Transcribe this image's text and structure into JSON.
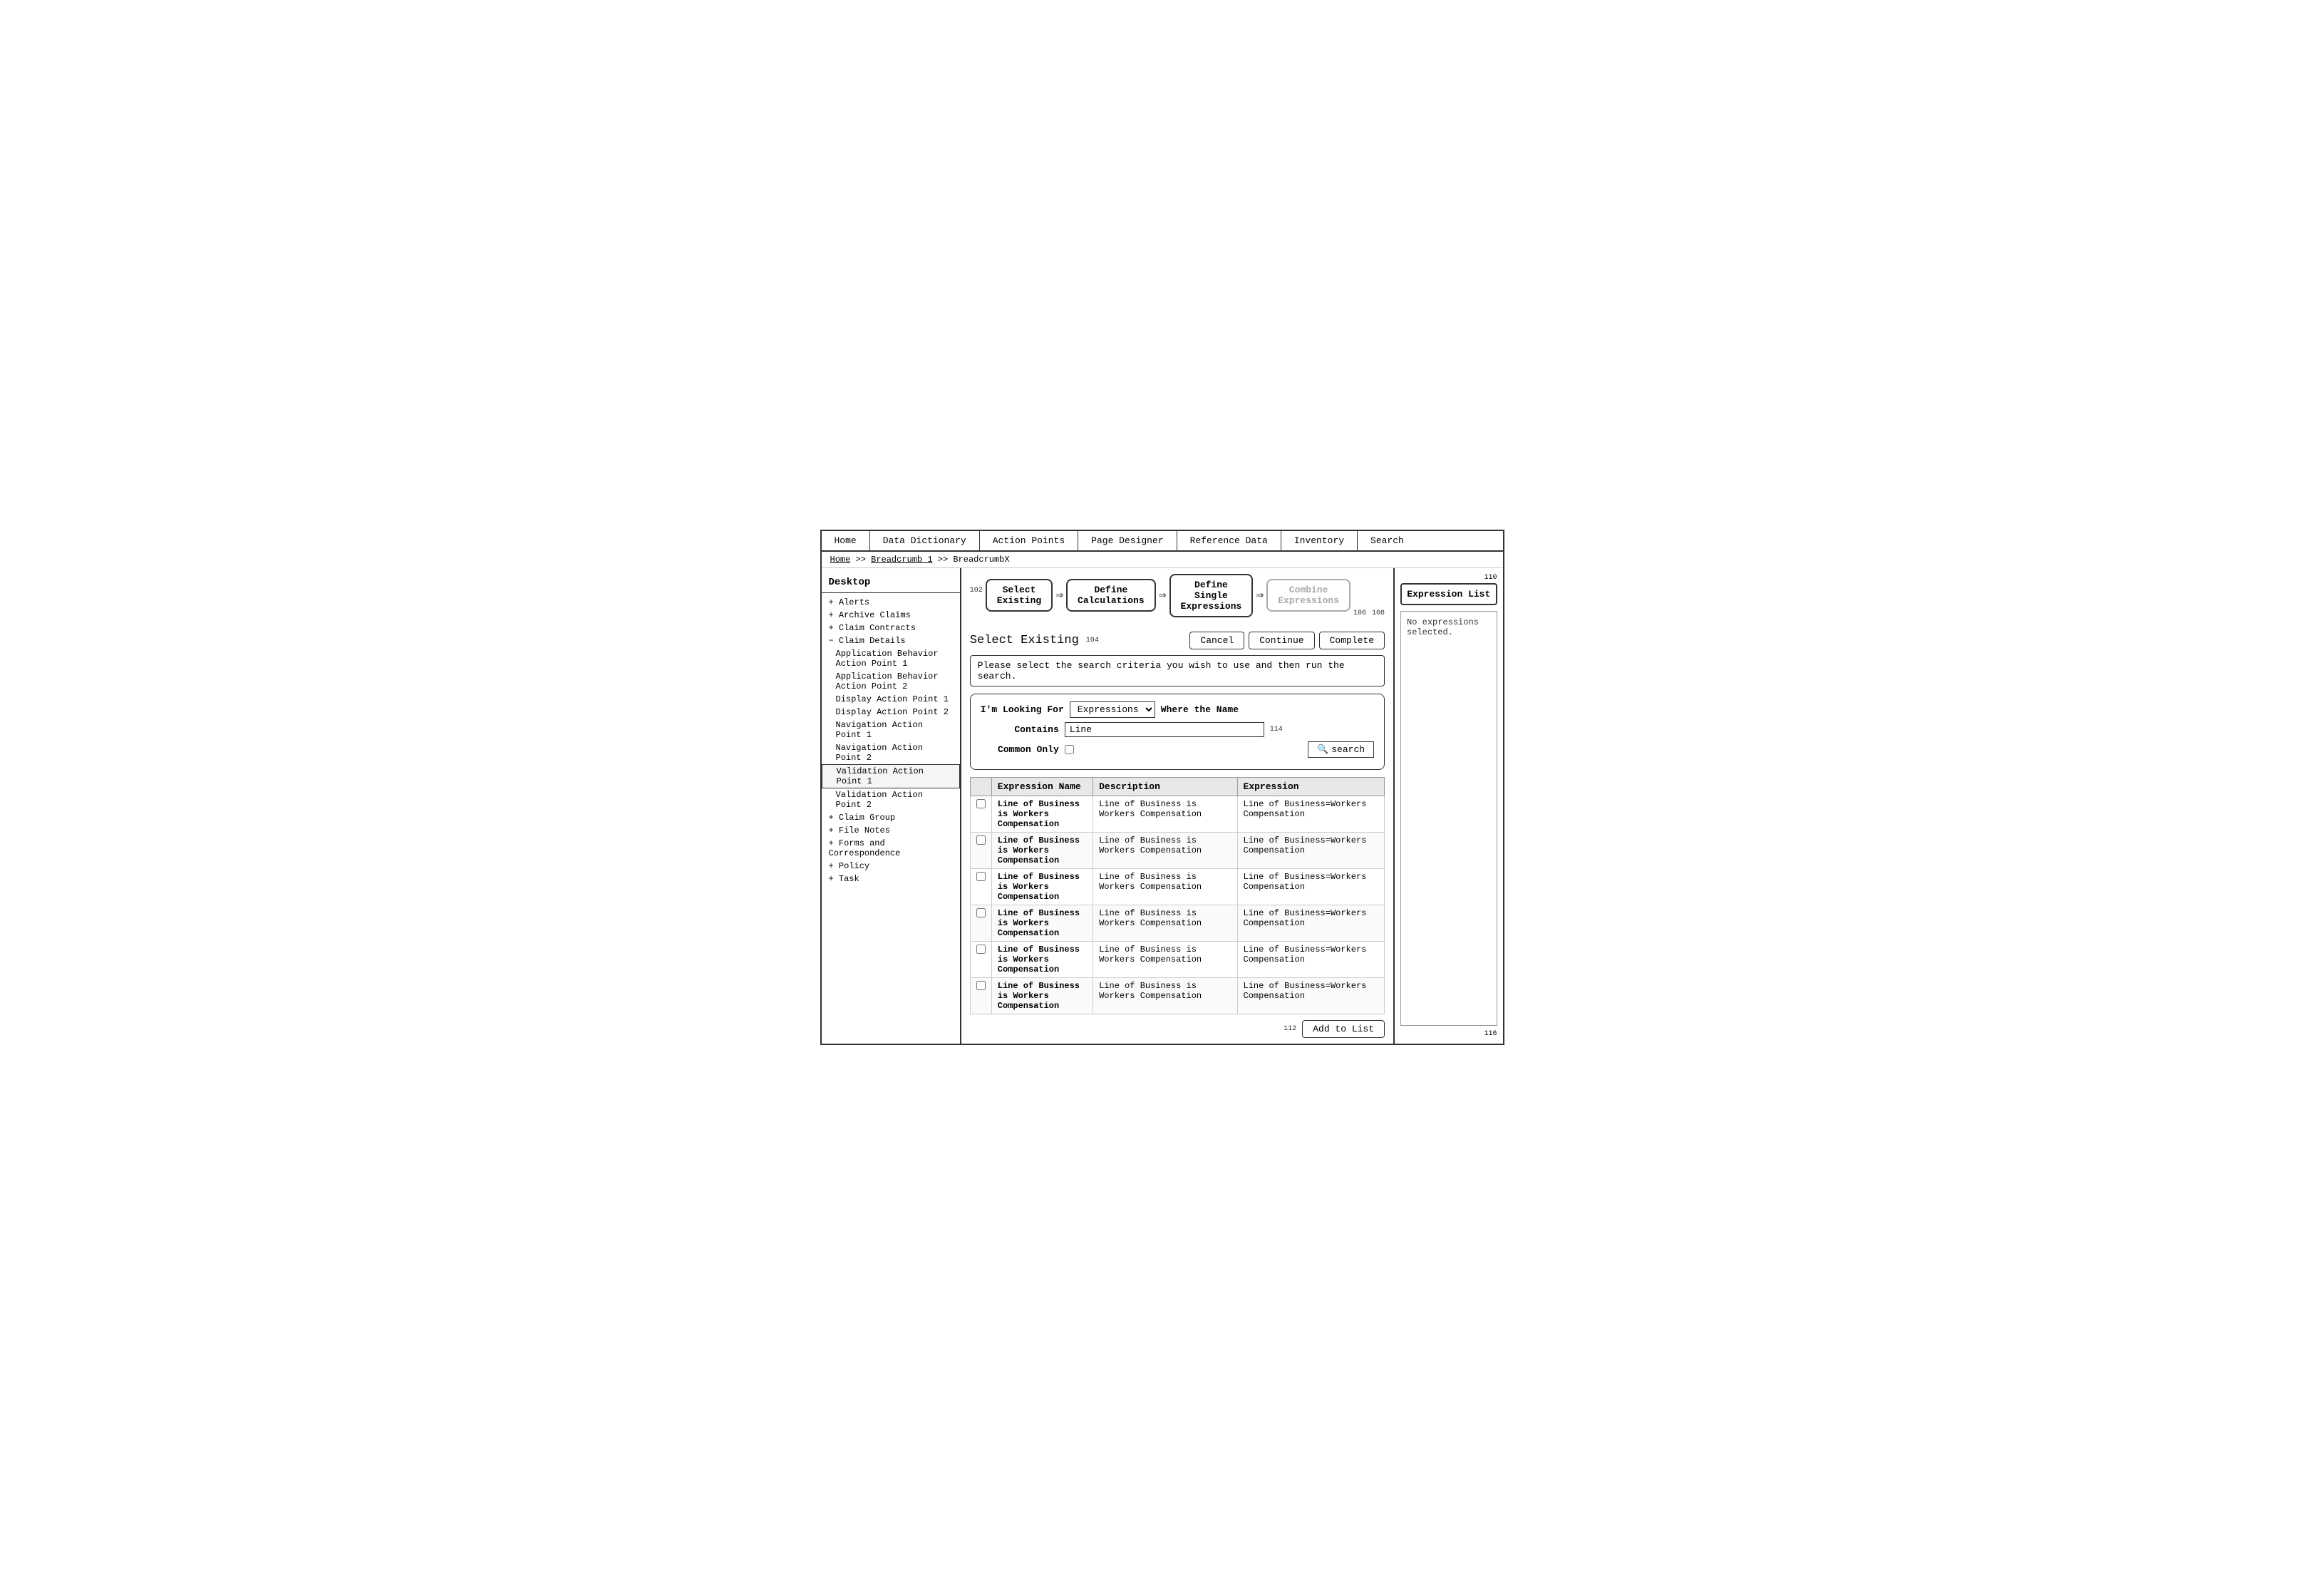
{
  "nav": {
    "items": [
      "Home",
      "Data Dictionary",
      "Action Points",
      "Page Designer",
      "Reference Data",
      "Inventory",
      "Search"
    ]
  },
  "breadcrumb": {
    "home": "Home",
    "separator1": ">>",
    "crumb1": "Breadcrumb 1",
    "separator2": ">>",
    "crumbX": "BreadcrumbX"
  },
  "sidebar": {
    "title": "Desktop",
    "items": [
      {
        "label": "+ Alerts",
        "indent": 0
      },
      {
        "label": "+ Archive Claims",
        "indent": 0
      },
      {
        "label": "+ Claim Contracts",
        "indent": 0
      },
      {
        "label": "− Claim Details",
        "indent": 0
      },
      {
        "label": "Application Behavior Action Point 1",
        "indent": 1
      },
      {
        "label": "Application Behavior Action Point 2",
        "indent": 1
      },
      {
        "label": "Display Action Point 1",
        "indent": 1
      },
      {
        "label": "Display Action Point 2",
        "indent": 1
      },
      {
        "label": "Navigation Action Point 1",
        "indent": 1
      },
      {
        "label": "Navigation Action Point 2",
        "indent": 1
      },
      {
        "label": "Validation Action Point 1",
        "indent": 1,
        "selected": true
      },
      {
        "label": "Validation Action Point 2",
        "indent": 1
      },
      {
        "label": "+ Claim Group",
        "indent": 0
      },
      {
        "label": "+ File Notes",
        "indent": 0
      },
      {
        "label": "+ Forms and Correspondence",
        "indent": 0
      },
      {
        "label": "+ Policy",
        "indent": 0
      },
      {
        "label": "+ Task",
        "indent": 0
      }
    ]
  },
  "wizard": {
    "ref102": "102",
    "steps": [
      {
        "label": "Select\nExisting",
        "active": true
      },
      {
        "label": "Define\nCalculations",
        "active": false
      },
      {
        "label": "Define\nSingle\nExpressions",
        "active": false
      },
      {
        "label": "Combine\nExpressions",
        "disabled": true
      }
    ],
    "ref106": "106",
    "ref108": "108"
  },
  "section": {
    "title": "Select Existing",
    "ref104": "104",
    "buttons": {
      "cancel": "Cancel",
      "continue": "Continue",
      "complete": "Complete"
    },
    "instructions": "Please select the search criteria you wish to use and then run the search."
  },
  "search": {
    "looking_for_label": "I'm Looking For",
    "looking_for_value": "Expressions",
    "where_label": "Where the Name",
    "contains_label": "Contains",
    "contains_value": "Line",
    "ref114": "114",
    "common_only_label": "Common Only",
    "search_button": "search"
  },
  "table": {
    "columns": [
      "Expression Name",
      "Description",
      "Expression"
    ],
    "rows": [
      {
        "name": "Line of Business is Workers Compensation",
        "description": "Line of Business is Workers Compensation",
        "expression": "Line of Business=Workers Compensation"
      },
      {
        "name": "Line of Business is Workers Compensation",
        "description": "Line of Business is Workers Compensation",
        "expression": "Line of Business=Workers Compensation"
      },
      {
        "name": "Line of Business is Workers Compensation",
        "description": "Line of Business is Workers Compensation",
        "expression": "Line of Business=Workers Compensation"
      },
      {
        "name": "Line of Business is Workers Compensation",
        "description": "Line of Business is Workers Compensation",
        "expression": "Line of Business=Workers Compensation"
      },
      {
        "name": "Line of Business is Workers Compensation",
        "description": "Line of Business is Workers Compensation",
        "expression": "Line of Business=Workers Compensation"
      },
      {
        "name": "Line of Business is Workers Compensation",
        "description": "Line of Business is Workers Compensation",
        "expression": "Line of Business=Workers Compensation"
      }
    ]
  },
  "add_to_list": {
    "ref112": "112",
    "label": "Add to List"
  },
  "right_panel": {
    "ref110": "110",
    "title": "Expression List",
    "content": "No expressions selected.",
    "ref116": "116"
  }
}
